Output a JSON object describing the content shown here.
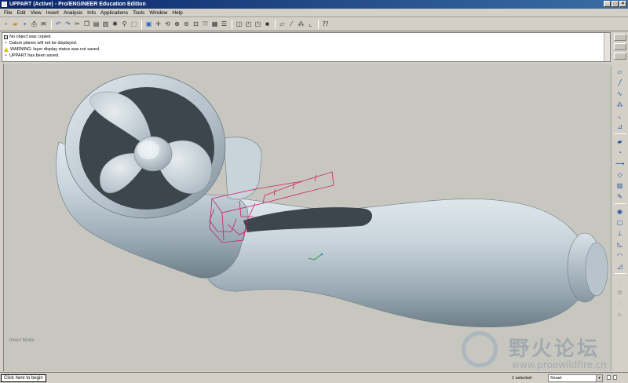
{
  "window": {
    "title": "UPPART (Active) - Pro/ENGINEER Education Edition",
    "controls": [
      "_",
      "□",
      "×"
    ]
  },
  "menubar": {
    "items": [
      "File",
      "Edit",
      "View",
      "Insert",
      "Analysis",
      "Info",
      "Applications",
      "Tools",
      "Window",
      "Help"
    ]
  },
  "toolbar": {
    "icons": [
      "new-icon",
      "open-icon",
      "save-icon",
      "print-icon",
      "email-icon",
      "undo-icon",
      "redo-icon",
      "cut-icon",
      "copy-icon",
      "paste-icon",
      "paste-special-icon",
      "regenerate-icon",
      "find-icon",
      "select-box-icon",
      "repaint-icon",
      "spin-center-icon",
      "orient-icon",
      "zoom-in-icon",
      "zoom-out-icon",
      "refit-icon",
      "reorient-icon",
      "saved-views-icon",
      "layers-icon",
      "wireframe-icon",
      "hidden-line-icon",
      "no-hidden-icon",
      "shading-icon",
      "datum-planes-icon",
      "datum-axes-icon",
      "datum-points-icon",
      "coord-sys-icon",
      "whats-this-icon"
    ]
  },
  "messages": [
    {
      "type": "info",
      "text": "No object was copied."
    },
    {
      "type": "bullet",
      "text": "Datum planes will not be displayed."
    },
    {
      "type": "warning",
      "text": "WARNING: layer display status was not saved."
    },
    {
      "type": "bullet",
      "text": "UPPART has been saved."
    }
  ],
  "graphics": {
    "mode_label": "Insert Mode",
    "background": "#c7c7c0",
    "model_color": "#c3cfd6",
    "highlight_color": "#cc1f66"
  },
  "right_toolbar": {
    "icons": [
      "datum-plane-icon",
      "datum-axis-icon",
      "datum-curve-icon",
      "datum-point-icon",
      "datum-csys-icon",
      "analysis-feature-icon",
      "extrude-icon",
      "revolve-icon",
      "variable-sweep-icon",
      "blend-icon",
      "boundary-blend-icon",
      "style-icon",
      "hole-icon",
      "shell-icon",
      "rib-icon",
      "draft-icon",
      "round-icon",
      "chamfer-icon",
      "trim-icon",
      "merge-icon",
      "pattern-icon",
      "mirror-icon"
    ]
  },
  "watermark": {
    "title": "野火论坛",
    "url": "www.proewildfire.cn"
  },
  "statusbar": {
    "hint": "Click here to begin",
    "selected": "1 selected",
    "filter": "Smart"
  }
}
